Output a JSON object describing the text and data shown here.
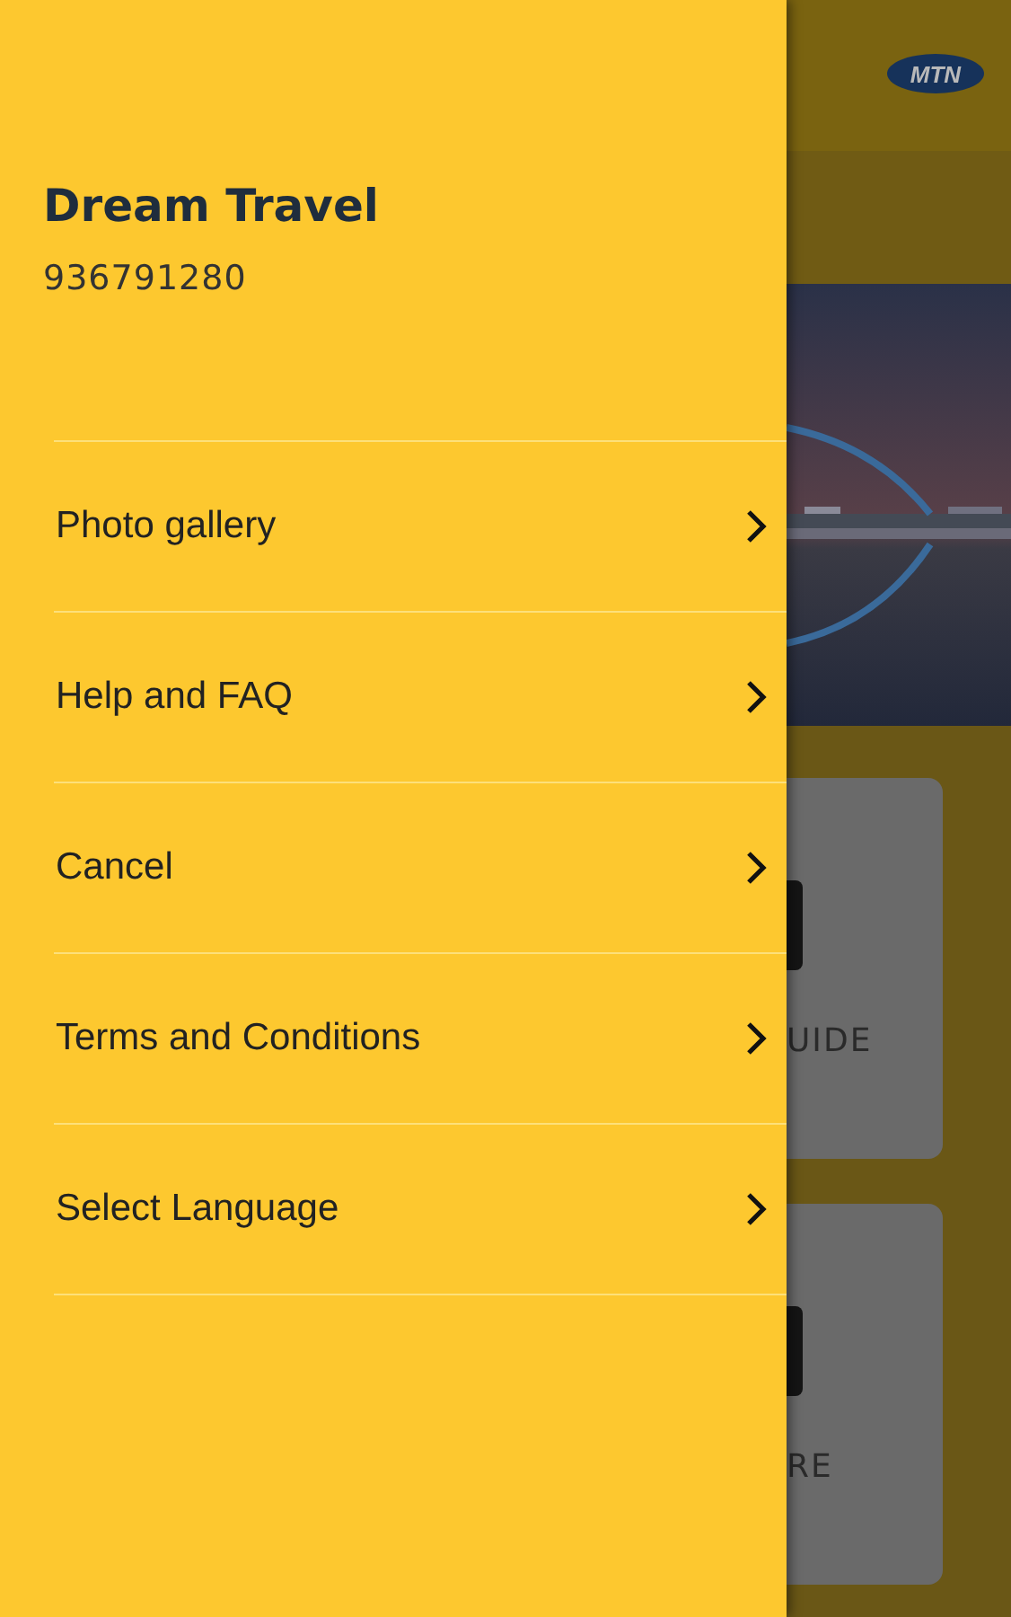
{
  "drawer": {
    "title": "Dream Travel",
    "subtitle": "936791280",
    "items": [
      {
        "label": "Photo gallery"
      },
      {
        "label": "Help and FAQ"
      },
      {
        "label": "Cancel"
      },
      {
        "label": "Terms and Conditions"
      },
      {
        "label": "Select Language"
      }
    ]
  },
  "background": {
    "logo": "MTN",
    "cards": [
      {
        "label": "UIDE"
      },
      {
        "label": "RE"
      }
    ]
  }
}
